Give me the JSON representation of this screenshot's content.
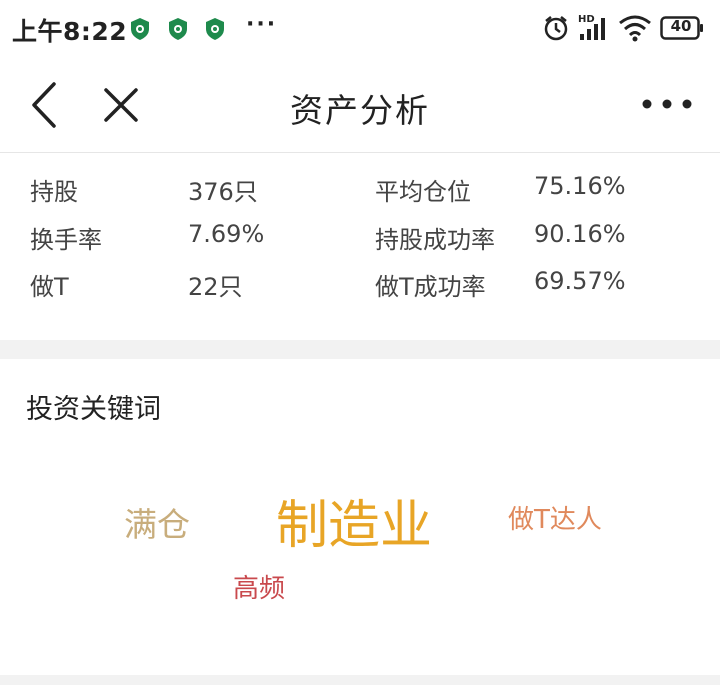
{
  "status_bar": {
    "time": "上午8:22",
    "more": "···",
    "battery": "40",
    "icons": [
      "shield-notification-icon",
      "shield-notification-icon",
      "shield-notification-icon",
      "alarm-icon",
      "hd-signal-icon",
      "wifi-icon",
      "battery-icon"
    ]
  },
  "nav": {
    "title": "资产分析",
    "back_icon": "chevron-left-icon",
    "close_icon": "close-icon",
    "more_icon": "more-dots-icon"
  },
  "stats": {
    "holdings_label": "持股",
    "holdings_value": "376只",
    "avg_position_label": "平均仓位",
    "avg_position_value": "75.16%",
    "turnover_label": "换手率",
    "turnover_value": "7.69%",
    "hold_success_label": "持股成功率",
    "hold_success_value": "90.16%",
    "t_trade_label": "做T",
    "t_trade_value": "22只",
    "t_success_label": "做T成功率",
    "t_success_value": "69.57%"
  },
  "keywords": {
    "heading": "投资关键词",
    "items": [
      {
        "text": "满仓",
        "color": "#c8ad7c"
      },
      {
        "text": "制造业",
        "color": "#e8a526"
      },
      {
        "text": "做T达人",
        "color": "#e0895c"
      },
      {
        "text": "高频",
        "color": "#c9494d"
      }
    ]
  },
  "colors": {
    "status_icon_green": "#1e8a4c",
    "divider": "#f2f2f2"
  }
}
